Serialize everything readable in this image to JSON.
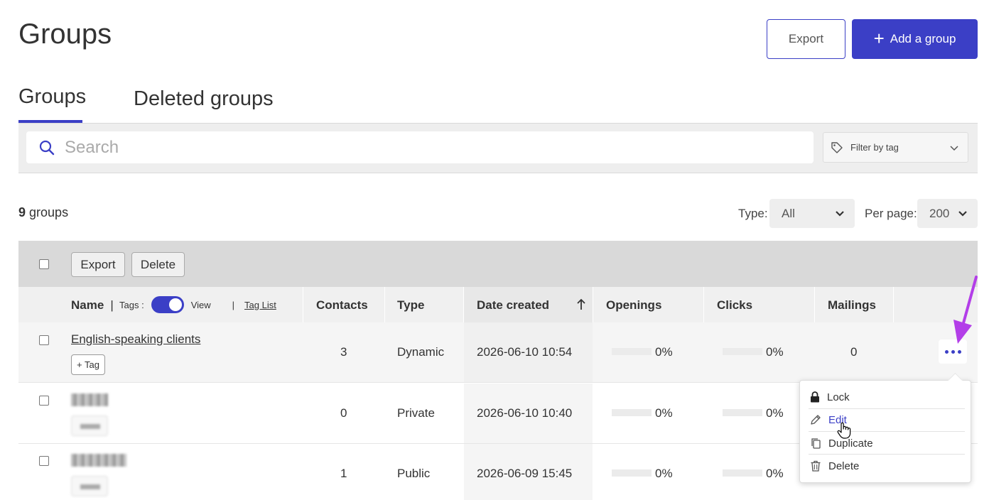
{
  "header": {
    "title": "Groups",
    "export_label": "Export",
    "add_label": "Add a group"
  },
  "tabs": [
    {
      "label": "Groups",
      "active": true
    },
    {
      "label": "Deleted groups",
      "active": false
    }
  ],
  "search": {
    "placeholder": "Search",
    "filter_label": "Filter by tag"
  },
  "summary": {
    "count": "9",
    "count_suffix": "groups",
    "type_label": "Type:",
    "type_value": "All",
    "per_page_label": "Per page:",
    "per_page_value": "200"
  },
  "bulk": {
    "export_label": "Export",
    "delete_label": "Delete"
  },
  "table": {
    "headers": {
      "name": "Name",
      "tags_label": "Tags :",
      "view_label": "View",
      "tag_list": "Tag List",
      "contacts": "Contacts",
      "type": "Type",
      "date_created": "Date created",
      "openings": "Openings",
      "clicks": "Clicks",
      "mailings": "Mailings"
    },
    "tag_button": "+ Tag",
    "rows": [
      {
        "name": "English-speaking clients",
        "contacts": "3",
        "type": "Dynamic",
        "date": "2026-06-10 10:54",
        "openings": "0%",
        "openings_fill": 0,
        "clicks": "0%",
        "clicks_fill": 0,
        "mailings": "0"
      },
      {
        "name": "",
        "contacts": "0",
        "type": "Private",
        "date": "2026-06-10 10:40",
        "openings": "0%",
        "openings_fill": 0,
        "clicks": "0%",
        "clicks_fill": 0,
        "mailings": ""
      },
      {
        "name": "",
        "contacts": "1",
        "type": "Public",
        "date": "2026-06-09 15:45",
        "openings": "0%",
        "openings_fill": 0,
        "clicks": "0%",
        "clicks_fill": 0,
        "mailings": ""
      }
    ]
  },
  "row_menu": {
    "lock": "Lock",
    "edit": "Edit",
    "duplicate": "Duplicate",
    "delete": "Delete"
  },
  "colors": {
    "accent": "#3b3fc6",
    "annotation_arrow": "#b33ee8"
  },
  "icons": [
    "search-icon",
    "tag-icon",
    "chevron-down-icon",
    "plus-icon",
    "sort-up-arrow-icon",
    "more-dots-icon",
    "lock-icon",
    "pencil-icon",
    "duplicate-icon",
    "trash-icon",
    "hand-cursor-icon"
  ]
}
